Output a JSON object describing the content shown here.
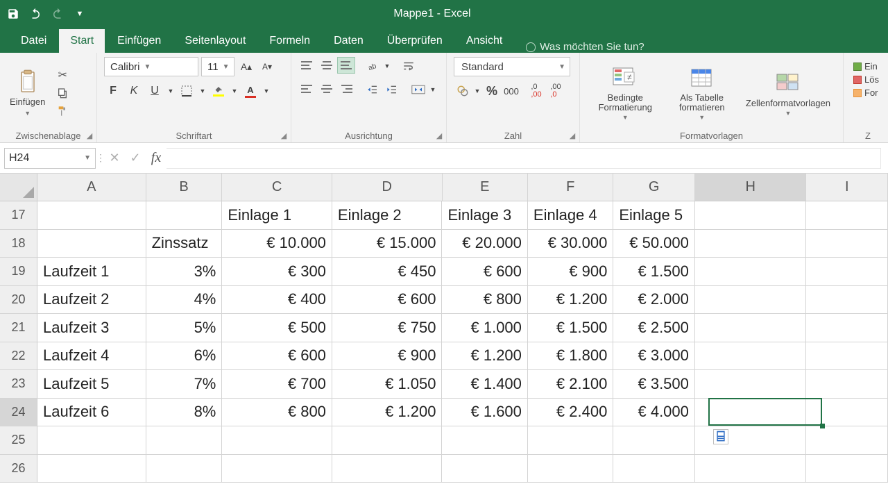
{
  "titlebar": {
    "title": "Mappe1 - Excel"
  },
  "tabs": {
    "items": [
      "Datei",
      "Start",
      "Einfügen",
      "Seitenlayout",
      "Formeln",
      "Daten",
      "Überprüfen",
      "Ansicht"
    ],
    "active": "Start",
    "tellme": "Was möchten Sie tun?"
  },
  "ribbon": {
    "clipboard": {
      "paste": "Einfügen",
      "label": "Zwischenablage"
    },
    "font": {
      "name": "Calibri",
      "size": "11",
      "label": "Schriftart"
    },
    "alignment": {
      "label": "Ausrichtung"
    },
    "number": {
      "format": "Standard",
      "label": "Zahl"
    },
    "styles": {
      "cond": "Bedingte Formatierung",
      "cond2": "",
      "table": "Als Tabelle formatieren",
      "table2": "",
      "cell": "Zellenformatvorlagen",
      "label": "Formatvorlagen"
    },
    "cells": {
      "insert": "Ein",
      "delete": "Lös",
      "format": "For",
      "label": "Z"
    }
  },
  "fbar": {
    "namebox": "H24",
    "formula": ""
  },
  "grid": {
    "colWidths": {
      "A": 160,
      "B": 112,
      "C": 162,
      "D": 162,
      "E": 126,
      "F": 126,
      "G": 120,
      "H": 164,
      "I": 120
    },
    "columns": [
      "A",
      "B",
      "C",
      "D",
      "E",
      "F",
      "G",
      "H",
      "I"
    ],
    "rowStart": 17,
    "rowEnd": 26,
    "selected": {
      "col": "H",
      "row": 24
    },
    "data": {
      "17": {
        "C": "Einlage 1",
        "D": "Einlage 2",
        "E": "Einlage 3",
        "F": "Einlage 4",
        "G": "Einlage 5"
      },
      "18": {
        "B": "Zinssatz",
        "C": "€ 10.000",
        "D": "€ 15.000",
        "E": "€ 20.000",
        "F": "€ 30.000",
        "G": "€ 50.000"
      },
      "19": {
        "A": "Laufzeit 1",
        "B": "3%",
        "C": "€ 300",
        "D": "€ 450",
        "E": "€ 600",
        "F": "€ 900",
        "G": "€ 1.500"
      },
      "20": {
        "A": "Laufzeit 2",
        "B": "4%",
        "C": "€ 400",
        "D": "€ 600",
        "E": "€ 800",
        "F": "€ 1.200",
        "G": "€ 2.000"
      },
      "21": {
        "A": "Laufzeit 3",
        "B": "5%",
        "C": "€ 500",
        "D": "€ 750",
        "E": "€ 1.000",
        "F": "€ 1.500",
        "G": "€ 2.500"
      },
      "22": {
        "A": "Laufzeit 4",
        "B": "6%",
        "C": "€ 600",
        "D": "€ 900",
        "E": "€ 1.200",
        "F": "€ 1.800",
        "G": "€ 3.000"
      },
      "23": {
        "A": "Laufzeit 5",
        "B": "7%",
        "C": "€ 700",
        "D": "€ 1.050",
        "E": "€ 1.400",
        "F": "€ 2.100",
        "G": "€ 3.500"
      },
      "24": {
        "A": "Laufzeit 6",
        "B": "8%",
        "C": "€ 800",
        "D": "€ 1.200",
        "E": "€ 1.600",
        "F": "€ 2.400",
        "G": "€ 4.000"
      }
    },
    "leftAlignCells": [
      "17.C",
      "17.D",
      "17.E",
      "17.F",
      "17.G",
      "18.B",
      "19.A",
      "20.A",
      "21.A",
      "22.A",
      "23.A",
      "24.A"
    ]
  }
}
